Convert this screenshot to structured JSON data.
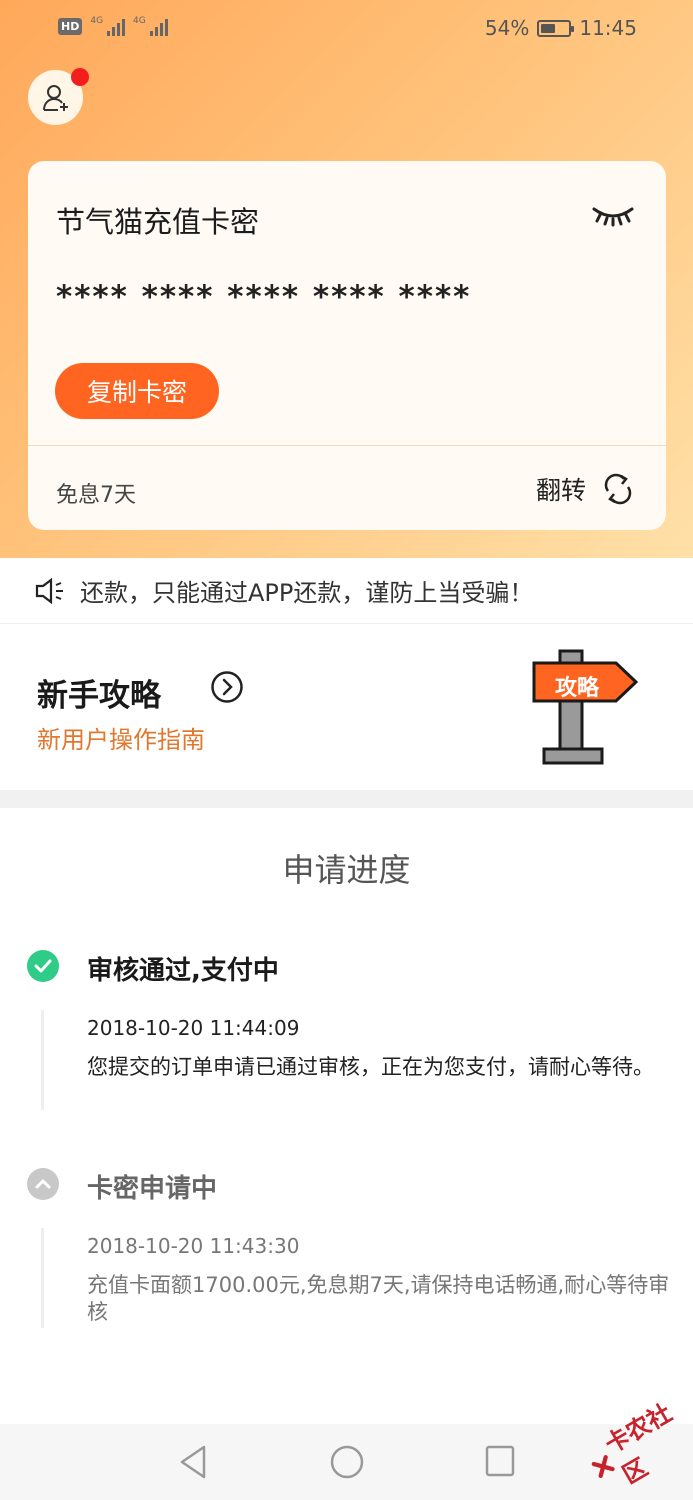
{
  "status_bar": {
    "hd": "HD",
    "net1": "4G",
    "net2": "4G",
    "battery_percent": "54%",
    "battery_level": 0.54,
    "time": "11:45"
  },
  "card": {
    "title": "节气猫充值卡密",
    "masked_number": "**** **** **** **** ****",
    "copy_label": "复制卡密",
    "interest_label": "免息7天",
    "flip_label": "翻转"
  },
  "notice": {
    "text": "还款，只能通过APP还款，谨防上当受骗！"
  },
  "guide": {
    "title": "新手攻略",
    "subtitle": "新用户操作指南",
    "sign_text": "攻略"
  },
  "progress": {
    "title": "申请进度",
    "steps": [
      {
        "status": "审核通过,支付中",
        "time": "2018-10-20 11:44:09",
        "desc": "您提交的订单申请已通过审核，正在为您支付，请耐心等待。",
        "icon": "check-circle-icon"
      },
      {
        "status": "卡密申请中",
        "time": "2018-10-20 11:43:30",
        "desc": "充值卡面额1700.00元,免息期7天,请保持电话畅通,耐心等待审核",
        "icon": "chevron-up-circle-icon"
      }
    ]
  },
  "colors": {
    "accent": "#ff6420",
    "success": "#2ecc87",
    "muted": "#bdbdbd"
  },
  "watermark": {
    "text": "卡农社区"
  }
}
